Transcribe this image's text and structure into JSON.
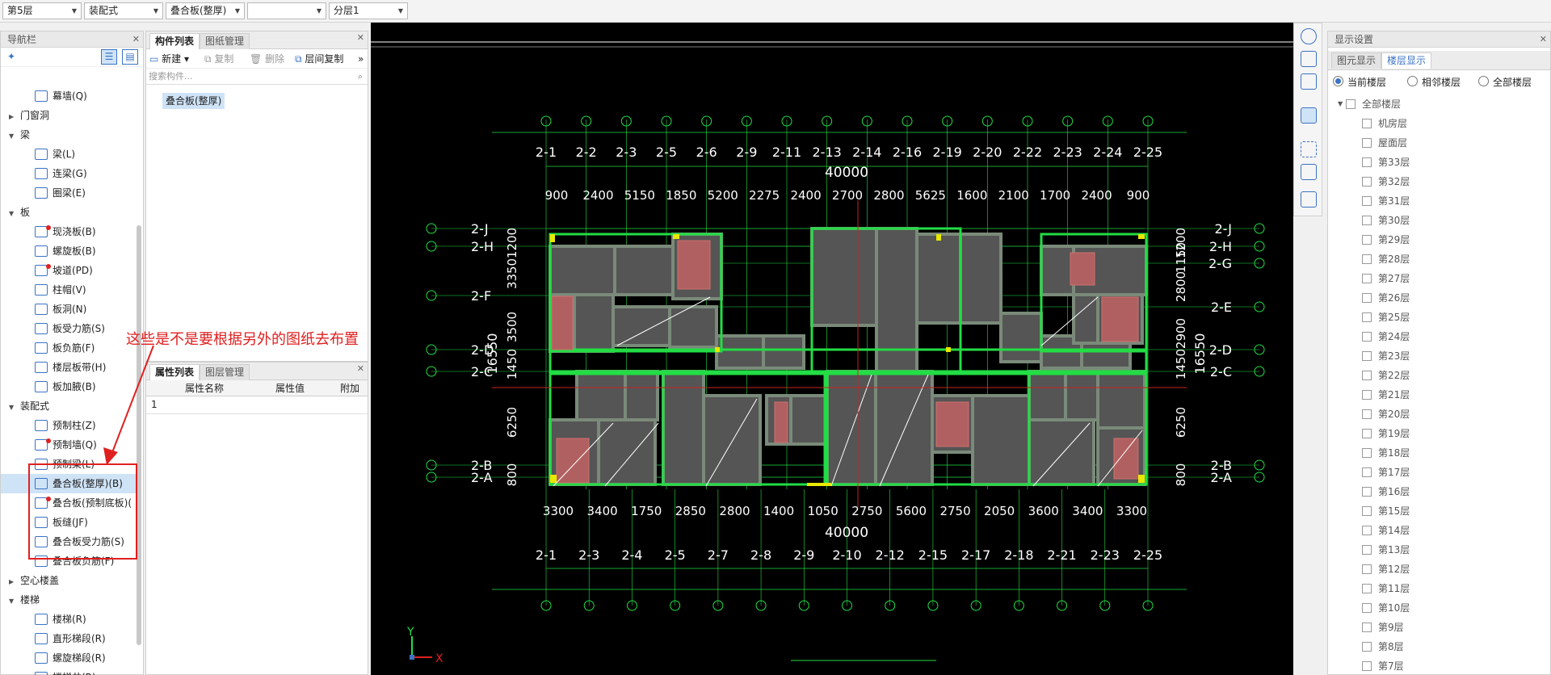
{
  "toolbar": {
    "floor": "第5层",
    "type": "装配式",
    "component": "叠合板(整厚)",
    "blank": "",
    "layer": "分层1"
  },
  "nav": {
    "title": "导航栏",
    "rows": [
      {
        "kind": "item",
        "label": "幕墙(Q)",
        "icon": "curtain-wall-icon",
        "dot": false
      },
      {
        "kind": "cat",
        "label": "门窗洞",
        "expanded": false
      },
      {
        "kind": "cat",
        "label": "梁",
        "expanded": true
      },
      {
        "kind": "item",
        "label": "梁(L)",
        "icon": "beam-icon",
        "dot": false
      },
      {
        "kind": "item",
        "label": "连梁(G)",
        "icon": "link-beam-icon",
        "dot": false
      },
      {
        "kind": "item",
        "label": "圈梁(E)",
        "icon": "ring-beam-icon",
        "dot": false
      },
      {
        "kind": "cat",
        "label": "板",
        "expanded": true
      },
      {
        "kind": "item",
        "label": "现浇板(B)",
        "icon": "cast-slab-icon",
        "dot": true
      },
      {
        "kind": "item",
        "label": "螺旋板(B)",
        "icon": "spiral-slab-icon",
        "dot": false
      },
      {
        "kind": "item",
        "label": "坡道(PD)",
        "icon": "ramp-icon",
        "dot": true
      },
      {
        "kind": "item",
        "label": "柱帽(V)",
        "icon": "column-cap-icon",
        "dot": false
      },
      {
        "kind": "item",
        "label": "板洞(N)",
        "icon": "slab-hole-icon",
        "dot": false
      },
      {
        "kind": "item",
        "label": "板受力筋(S)",
        "icon": "slab-rebar-icon",
        "dot": false
      },
      {
        "kind": "item",
        "label": "板负筋(F)",
        "icon": "slab-neg-rebar-icon",
        "dot": false
      },
      {
        "kind": "item",
        "label": "楼层板带(H)",
        "icon": "floor-strip-icon",
        "dot": false
      },
      {
        "kind": "item",
        "label": "板加腋(B)",
        "icon": "slab-haunch-icon",
        "dot": false
      },
      {
        "kind": "cat",
        "label": "装配式",
        "expanded": true
      },
      {
        "kind": "item",
        "label": "预制柱(Z)",
        "icon": "precast-column-icon",
        "dot": false
      },
      {
        "kind": "item",
        "label": "预制墙(Q)",
        "icon": "precast-wall-icon",
        "dot": true
      },
      {
        "kind": "item",
        "label": "预制梁(L)",
        "icon": "precast-beam-icon",
        "dot": false
      },
      {
        "kind": "item",
        "label": "叠合板(整厚)(B)",
        "icon": "composite-slab-icon",
        "dot": false,
        "selected": true
      },
      {
        "kind": "item",
        "label": "叠合板(预制底板)(",
        "icon": "composite-base-icon",
        "dot": true
      },
      {
        "kind": "item",
        "label": "板缝(JF)",
        "icon": "slab-joint-icon",
        "dot": false
      },
      {
        "kind": "item",
        "label": "叠合板受力筋(S)",
        "icon": "composite-rebar-icon",
        "dot": false
      },
      {
        "kind": "item",
        "label": "叠合板负筋(F)",
        "icon": "composite-neg-rebar-icon",
        "dot": false
      },
      {
        "kind": "cat",
        "label": "空心楼盖",
        "expanded": false
      },
      {
        "kind": "cat",
        "label": "楼梯",
        "expanded": true
      },
      {
        "kind": "item",
        "label": "楼梯(R)",
        "icon": "stair-icon",
        "dot": false
      },
      {
        "kind": "item",
        "label": "直形梯段(R)",
        "icon": "straight-stair-icon",
        "dot": false
      },
      {
        "kind": "item",
        "label": "螺旋梯段(R)",
        "icon": "spiral-stair-icon",
        "dot": false
      },
      {
        "kind": "item",
        "label": "楼梯井(R)",
        "icon": "stairwell-icon",
        "dot": false
      }
    ]
  },
  "complist": {
    "tab_active": "构件列表",
    "tab_other": "图纸管理",
    "new": "新建",
    "copy": "复制",
    "delete": "删除",
    "floor_copy": "层间复制",
    "search_placeholder": "搜索构件...",
    "item": "叠合板(整厚)"
  },
  "props": {
    "tab_active": "属性列表",
    "tab_other": "图层管理",
    "col_name": "属性名称",
    "col_value": "属性值",
    "col_extra": "附加",
    "row_index": "1"
  },
  "display": {
    "title": "显示设置",
    "tab_other": "图元显示",
    "tab_active": "楼层显示",
    "radio_current": "当前楼层",
    "radio_adjacent": "相邻楼层",
    "radio_all": "全部楼层",
    "group": "全部楼层",
    "floors": [
      "机房层",
      "屋面层",
      "第33层",
      "第32层",
      "第31层",
      "第30层",
      "第29层",
      "第28层",
      "第27层",
      "第26层",
      "第25层",
      "第24层",
      "第23层",
      "第22层",
      "第21层",
      "第20层",
      "第19层",
      "第18层",
      "第17层",
      "第16层",
      "第15层",
      "第14层",
      "第13层",
      "第12层",
      "第11层",
      "第10层",
      "第9层",
      "第8层",
      "第7层"
    ]
  },
  "drawing": {
    "total_top": "40000",
    "total_bottom": "40000",
    "top_axes": [
      "2-1",
      "2-2",
      "2-3",
      "2-5",
      "2-6",
      "2-9",
      "2-11",
      "2-13",
      "2-14",
      "2-16",
      "2-19",
      "2-20",
      "2-22",
      "2-23",
      "2-24",
      "2-25"
    ],
    "top_dims": [
      "900",
      "2400",
      "5150",
      "1850",
      "5200",
      "2275",
      "2400",
      "2700",
      "2800",
      "5625",
      "1600",
      "2100",
      "1700",
      "2400",
      "900"
    ],
    "bottom_dims": [
      "3300",
      "3400",
      "1750",
      "2850",
      "2800",
      "1400",
      "1050",
      "2750",
      "5600",
      "2750",
      "2050",
      "3600",
      "3400",
      "3300"
    ],
    "bottom_axes": [
      "2-1",
      "2-3",
      "2-4",
      "2-5",
      "2-7",
      "2-8",
      "2-9",
      "2-10",
      "2-12",
      "2-15",
      "2-17",
      "2-18",
      "2-21",
      "2-23",
      "2-25"
    ],
    "left_axes": [
      "2-J",
      "2-H",
      "2-F",
      "2-D",
      "2-C",
      "2-B",
      "2-A"
    ],
    "right_axes": [
      "2-J",
      "2-H",
      "2-G",
      "2-E",
      "2-D",
      "2-C",
      "2-B",
      "2-A"
    ],
    "left_dims": [
      "1200",
      "3350",
      "3500",
      "1450",
      "6250",
      "800"
    ],
    "left_total": "16550",
    "right_dims": [
      "1200",
      "1150",
      "2800",
      "2900",
      "1450",
      "6250",
      "800"
    ],
    "right_total": "16550",
    "axis_x": "X",
    "axis_y": "Y"
  },
  "annotation": {
    "text": "这些是不是要根据另外的图纸去布置",
    "color": "#e02020"
  },
  "colors": {
    "accent": "#3b73c4",
    "cad_green": "#22dd44",
    "cad_wall": "#7a8a7a",
    "cad_slab": "#555555",
    "cad_hatch": "#b06060",
    "cad_yellow": "#e8e800"
  }
}
